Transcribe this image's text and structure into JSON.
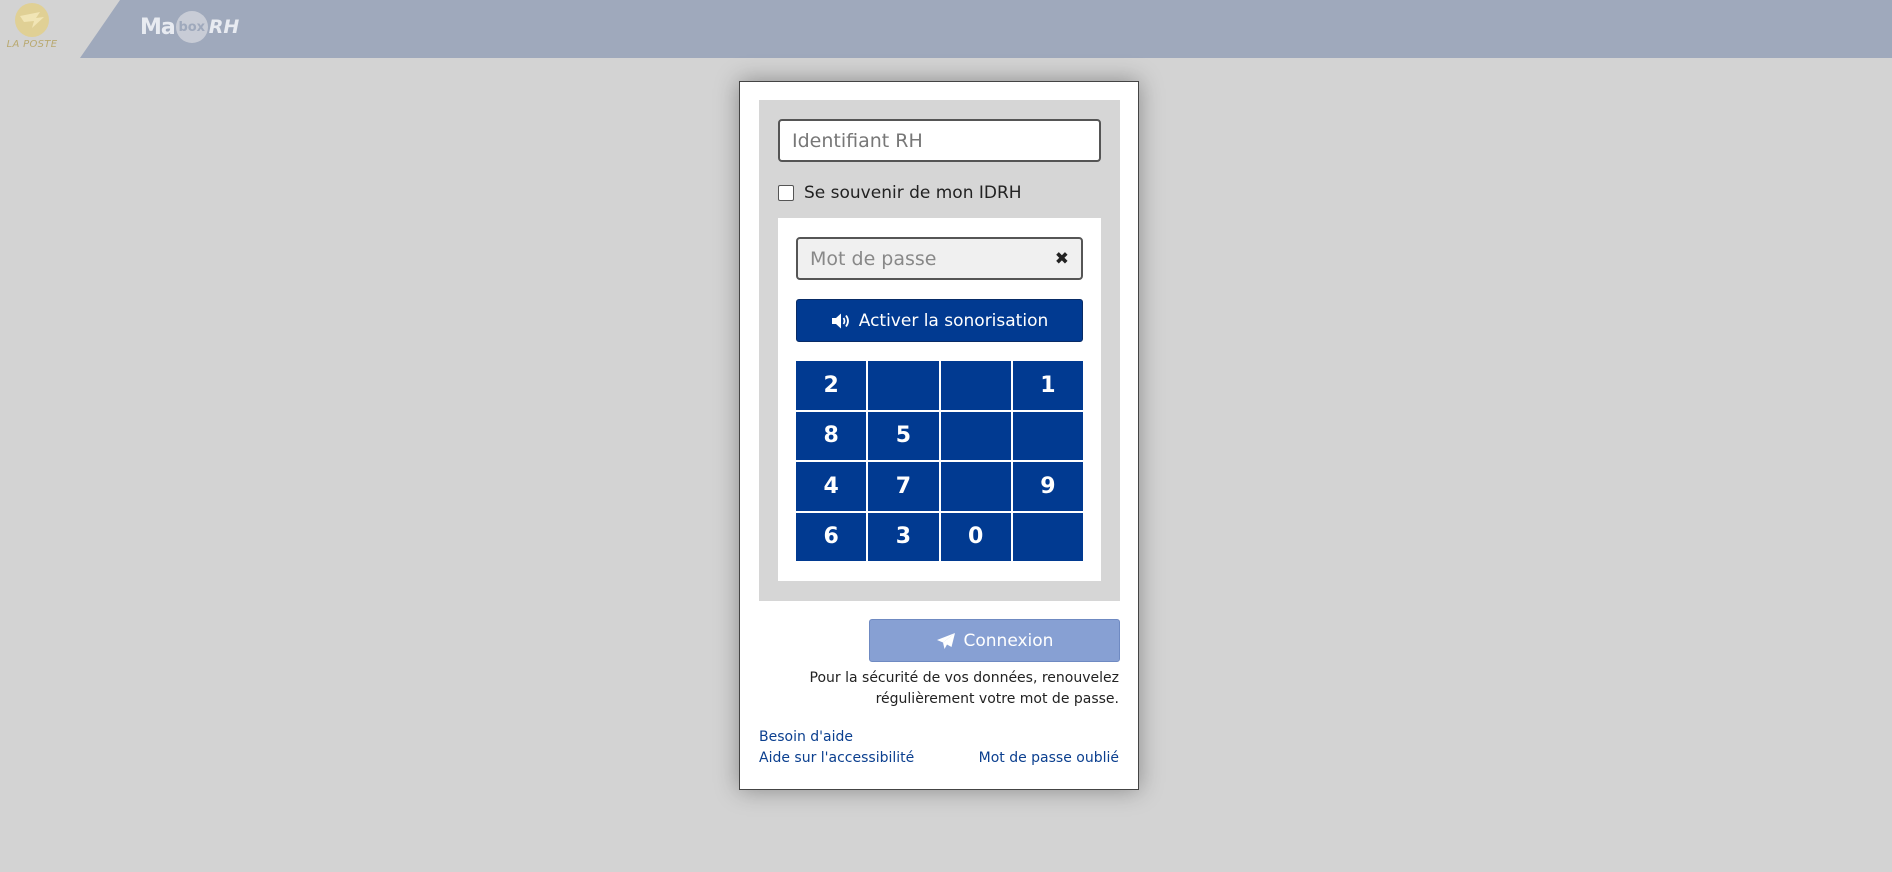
{
  "header": {
    "laposte_brand": "LA POSTE",
    "app_logo": {
      "part1": "Ma",
      "part2": "box",
      "part3": "RH"
    }
  },
  "login": {
    "id_placeholder": "Identifiant RH",
    "remember_label": "Se souvenir de mon IDRH",
    "remember_checked": false,
    "password_placeholder": "Mot de passe",
    "clear_icon": "✖",
    "sound_button_label": "Activer la sonorisation",
    "keypad": [
      "2",
      "",
      "",
      "1",
      "8",
      "5",
      "",
      "",
      "4",
      "7",
      "",
      "9",
      "6",
      "3",
      "0",
      ""
    ],
    "connect_label": "Connexion",
    "security_notice": "Pour la sécurité de vos données, renouvelez régulièrement votre mot de passe.",
    "help_link": "Besoin d'aide",
    "accessibility_link": "Aide sur l'accessibilité",
    "forgot_link": "Mot de passe oublié"
  },
  "colors": {
    "primary": "#013a91",
    "connect_disabled": "#87a0d3",
    "header_bar": "#9fa9bc",
    "link": "#0b3f8f"
  },
  "icons": {
    "sound": "volume-icon",
    "connect": "paper-plane-icon",
    "clear": "close-icon"
  }
}
